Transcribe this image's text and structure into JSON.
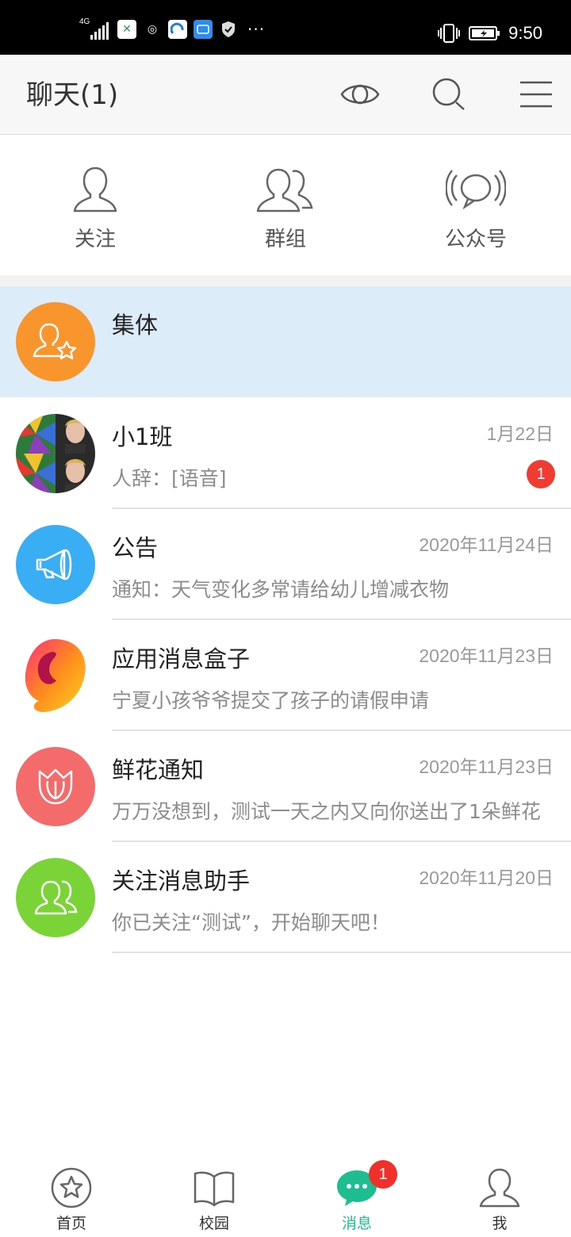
{
  "status_bar": {
    "network_label": "4G",
    "time": "9:50"
  },
  "header": {
    "title": "聊天(1)"
  },
  "categories": [
    {
      "label": "关注",
      "icon": "person-outline-icon"
    },
    {
      "label": "群组",
      "icon": "group-outline-icon"
    },
    {
      "label": "公众号",
      "icon": "broadcast-outline-icon"
    }
  ],
  "chats": [
    {
      "name": "集体",
      "time": "",
      "preview": "",
      "avatar_color": "#f8952d",
      "icon": "person-star-icon",
      "highlighted": true
    },
    {
      "name": "小1班",
      "time": "1月22日",
      "preview": "人辞：[语音]",
      "unread": "1",
      "icon": "group-photo-avatar"
    },
    {
      "name": "公告",
      "time": "2020年11月24日",
      "preview": "通知：天气变化多常请给幼儿增减衣物",
      "avatar_color": "#3aaef5",
      "icon": "megaphone-icon"
    },
    {
      "name": "应用消息盒子",
      "time": "2020年11月23日",
      "preview": "宁夏小孩爷爷提交了孩子的请假申请",
      "icon": "app-box-logo"
    },
    {
      "name": "鲜花通知",
      "time": "2020年11月23日",
      "preview": "万万没想到，测试一天之内又向你送出了1朵鲜花",
      "avatar_color": "#f46b6b",
      "icon": "flower-icon"
    },
    {
      "name": "关注消息助手",
      "time": "2020年11月20日",
      "preview": "你已关注“测试”，开始聊天吧！",
      "avatar_color": "#7bd437",
      "icon": "person-follow-icon"
    }
  ],
  "tabbar": {
    "items": [
      {
        "label": "首页",
        "icon": "star-circle-icon"
      },
      {
        "label": "校园",
        "icon": "open-book-icon"
      },
      {
        "label": "消息",
        "icon": "chat-bubble-icon",
        "active": true
      },
      {
        "label": "我",
        "icon": "person-icon"
      }
    ],
    "message_badge": "1"
  },
  "colors": {
    "accent": "#1dbd8f",
    "badge": "#f03b32",
    "highlight_row": "#dcecf9"
  }
}
